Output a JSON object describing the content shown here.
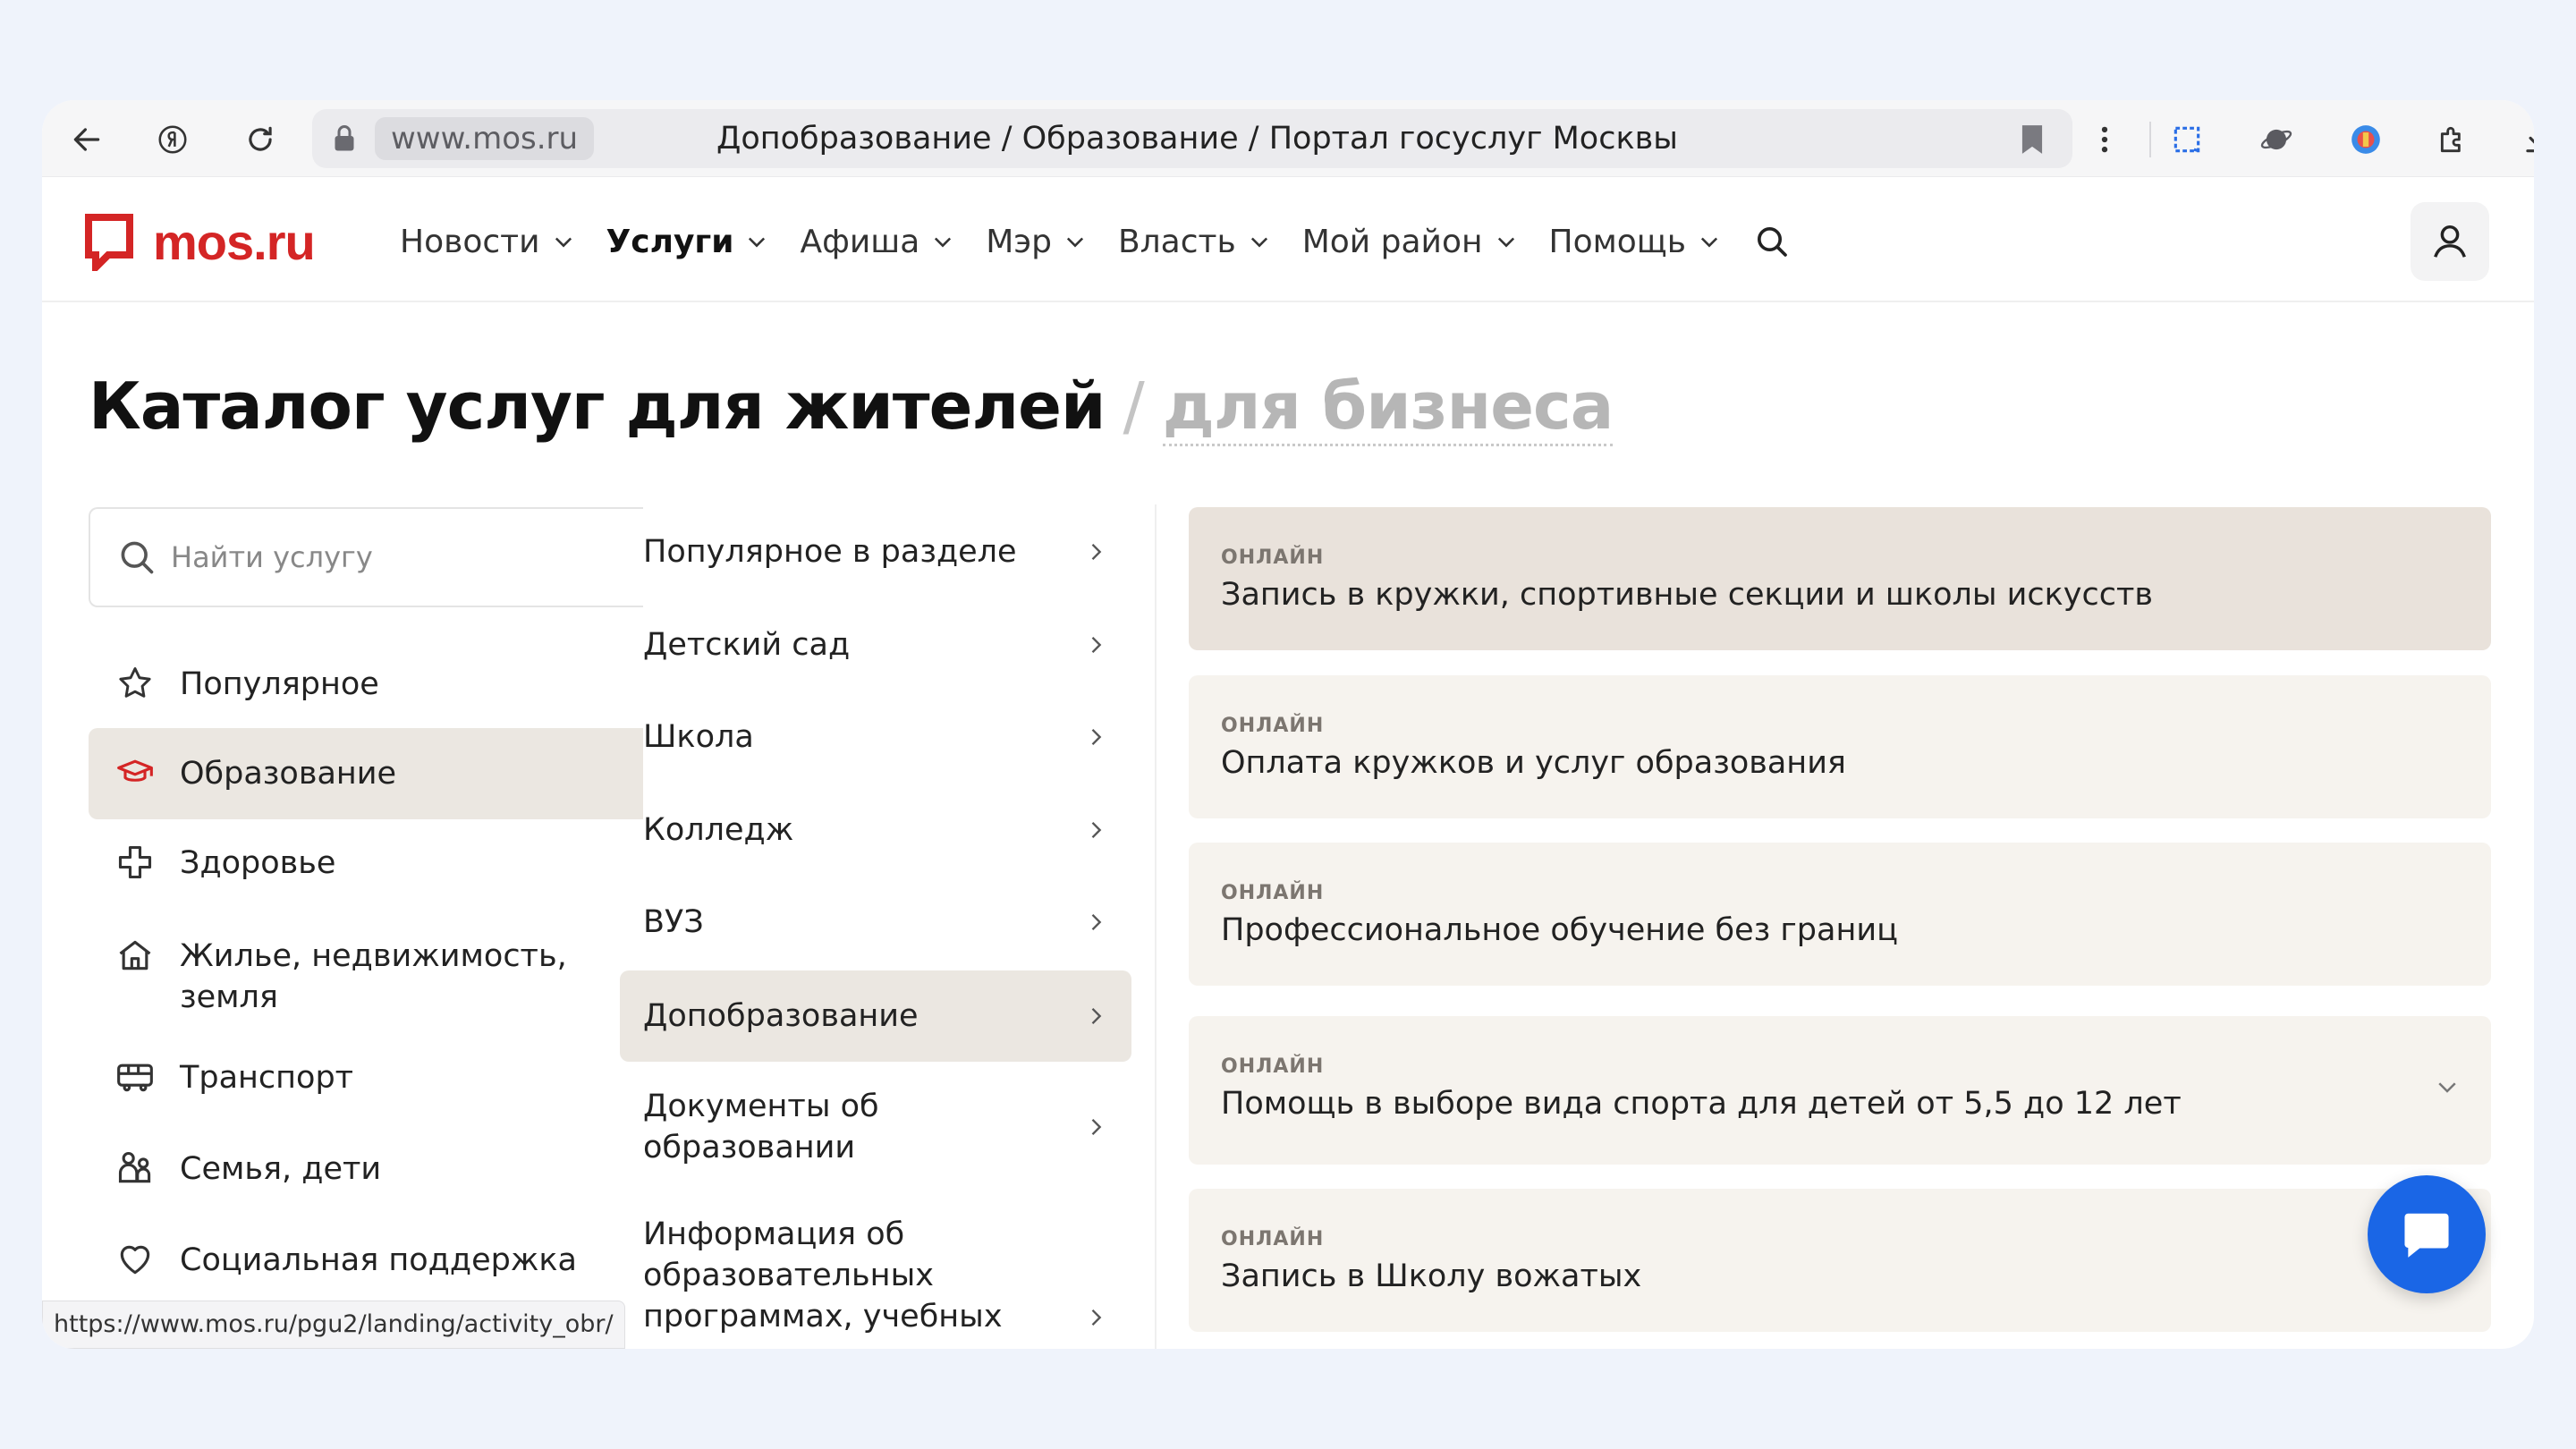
{
  "browser": {
    "domain": "www.mos.ru",
    "tab_title": "Допобразование / Образование / Портал госуслуг Москвы",
    "status_url": "https://www.mos.ru/pgu2/landing/activity_obr/"
  },
  "site": {
    "logo_text": "mos.ru",
    "brand_color": "#d42525",
    "nav": [
      {
        "label": "Новости",
        "active": false
      },
      {
        "label": "Услуги",
        "active": true
      },
      {
        "label": "Афиша",
        "active": false
      },
      {
        "label": "Мэр",
        "active": false
      },
      {
        "label": "Власть",
        "active": false
      },
      {
        "label": "Мой район",
        "active": false
      },
      {
        "label": "Помощь",
        "active": false
      }
    ]
  },
  "heading": {
    "main": "Каталог услуг для жителей",
    "separator": "/",
    "secondary": "для бизнеса"
  },
  "search": {
    "placeholder": "Найти услугу"
  },
  "categories": [
    {
      "label": "Популярное",
      "icon": "star-icon",
      "active": false
    },
    {
      "label": "Образование",
      "icon": "graduation-cap-icon",
      "active": true
    },
    {
      "label": "Здоровье",
      "icon": "health-cross-icon",
      "active": false
    },
    {
      "label": "Жилье, недвижимость, земля",
      "icon": "house-icon",
      "active": false
    },
    {
      "label": "Транспорт",
      "icon": "bus-icon",
      "active": false
    },
    {
      "label": "Семья, дети",
      "icon": "family-icon",
      "active": false
    },
    {
      "label": "Социальная поддержка",
      "icon": "heart-icon",
      "active": false
    }
  ],
  "subcategories": [
    {
      "label": "Популярное в разделе",
      "active": false
    },
    {
      "label": "Детский сад",
      "active": false
    },
    {
      "label": "Школа",
      "active": false
    },
    {
      "label": "Колледж",
      "active": false
    },
    {
      "label": "ВУЗ",
      "active": false
    },
    {
      "label": "Допобразование",
      "active": true
    },
    {
      "label": "Документы об образовании",
      "active": false
    },
    {
      "label": "Информация об образовательных программах, учебных",
      "active": false
    }
  ],
  "services": [
    {
      "badge": "ОНЛАЙН",
      "title": "Запись в кружки, спортивные секции и школы искусств",
      "active": true
    },
    {
      "badge": "ОНЛАЙН",
      "title": "Оплата кружков и услуг образования",
      "active": false
    },
    {
      "badge": "ОНЛАЙН",
      "title": "Профессиональное обучение без границ",
      "active": false
    },
    {
      "badge": "ОНЛАЙН",
      "title": "Помощь в выборе вида спорта для детей от 5,5 до 12 лет",
      "active": false
    },
    {
      "badge": "ОНЛАЙН",
      "title": "Запись в Школу вожатых",
      "active": false
    }
  ]
}
